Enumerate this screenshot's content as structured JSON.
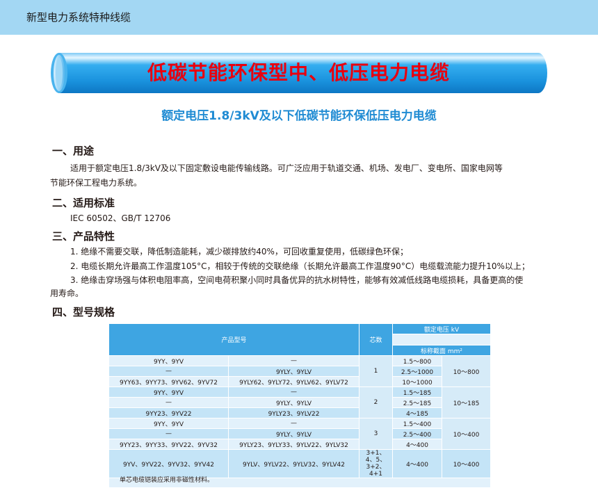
{
  "header": {
    "title": "新型电力系统特种线缆"
  },
  "banner": {
    "title": "低碳节能环保型中、低压电力电缆"
  },
  "subtitle": "额定电压1.8/3kV及以下低碳节能环保低压电力电缆",
  "sections": {
    "usage": {
      "heading": "一、用途",
      "line1": "适用于额定电压1.8/3kV及以下固定敷设电能传输线路。可广泛应用于轨道交通、机场、发电厂、变电所、国家电网等",
      "line2": "节能环保工程电力系统。"
    },
    "standard": {
      "heading": "二、适用标准",
      "text": "IEC 60502、GB/T 12706"
    },
    "features": {
      "heading": "三、产品特性",
      "item1": "1. 绝缘不需要交联，降低制造能耗，减少碳排放约40%，可回收重复使用，低碳绿色环保；",
      "item2": "2. 电缆长期允许最高工作温度105°C，相较于传统的交联绝缘（长期允许最高工作温度90°C）电缆载流能力提升10%以上；",
      "item3a": "3. 绝缘击穿场强与体积电阻率高，空间电荷积聚小同时具备优异的抗水树特性，能够有效减低线路电缆损耗，具备更高的使",
      "item3b": "用寿命。"
    },
    "spec": {
      "heading": "四、型号规格"
    }
  },
  "table": {
    "header": {
      "model": "产品型号",
      "cores": "芯数",
      "voltage": "额定电压 kV",
      "area": "标称截面 mm²"
    },
    "groups": [
      {
        "cores": "1",
        "range": "10～800",
        "rows": [
          {
            "cu": "9YY、9YV",
            "al": "—",
            "sec": "1.5～800"
          },
          {
            "cu": "—",
            "al": "9YLY、9YLV",
            "sec": "2.5～1000"
          },
          {
            "cu": "9YY63、9YY73、9YV62、9YV72",
            "al": "9YLY62、9YLY72、9YLV62、9YLV72",
            "sec": "10～1000"
          }
        ]
      },
      {
        "cores": "2",
        "range": "10～185",
        "rows": [
          {
            "cu": "9YY、9YV",
            "al": "—",
            "sec": "1.5～185"
          },
          {
            "cu": "—",
            "al": "9YLY、9YLV",
            "sec": "2.5～185"
          },
          {
            "cu": "9YY23、9YV22",
            "al": "9YLY23、9YLV22",
            "sec": "4～185"
          }
        ]
      },
      {
        "cores": "3",
        "range": "10～400",
        "rows": [
          {
            "cu": "9YY、9YV",
            "al": "—",
            "sec": "1.5～400"
          },
          {
            "cu": "—",
            "al": "9YLY、9YLV",
            "sec": "2.5～400"
          },
          {
            "cu": "9YY23、9YY33、9YV22、9YV32",
            "al": "9YLY23、9YLY33、9YLV22、9YLV32",
            "sec": "4～400"
          }
        ]
      },
      {
        "cores": "3+1、4、5、3+2、4+1",
        "range": "10～400",
        "rows": [
          {
            "cu": "9YV、9YV22、9YV32、9YV42",
            "al": "9YLV、9YLV22、9YLV32、9YLV42",
            "sec": "4～400"
          }
        ]
      }
    ],
    "footnote": "单芯电缆铠装应采用非磁性材料。"
  },
  "colors": {
    "header_bar": "#a3d7f3",
    "banner_tube": "#1e9ee8",
    "banner_text": "#e8000f",
    "subtitle": "#1f8bd3",
    "table_header": "#3ea5e2"
  }
}
